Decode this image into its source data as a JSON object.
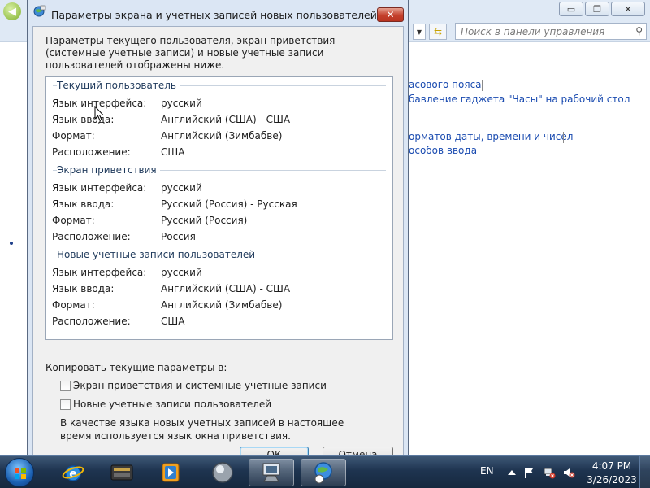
{
  "background_window": {
    "controls": {
      "minimize": "▭",
      "maximize": "❐",
      "close": "✕"
    },
    "address": {
      "dropdown": "▼",
      "refresh": "⇆"
    },
    "search": {
      "placeholder": "Поиск в панели управления"
    },
    "links": [
      {
        "text": "асового пояса"
      },
      {
        "text": "бавление гаджета \"Часы\" на рабочий стол"
      },
      {
        "text": "орматов даты, времени и чисел"
      },
      {
        "text": "особов ввода"
      }
    ]
  },
  "dialog": {
    "title": "Параметры экрана и учетных записей новых пользователей",
    "close_label": "✕",
    "intro": "Параметры текущего пользователя, экран приветствия (системные учетные записи) и новые учетные записи пользователей отображены ниже.",
    "sections": [
      {
        "title": "Текущий пользователь",
        "rows": [
          {
            "label": "Язык интерфейса:",
            "value": "русский"
          },
          {
            "label": "Язык ввода:",
            "value": "Английский (США) - США"
          },
          {
            "label": "Формат:",
            "value": "Английский (Зимбабве)"
          },
          {
            "label": "Расположение:",
            "value": "США"
          }
        ]
      },
      {
        "title": "Экран приветствия",
        "rows": [
          {
            "label": "Язык интерфейса:",
            "value": "русский"
          },
          {
            "label": "Язык ввода:",
            "value": "Русский (Россия) - Русская"
          },
          {
            "label": "Формат:",
            "value": "Русский (Россия)"
          },
          {
            "label": "Расположение:",
            "value": "Россия"
          }
        ]
      },
      {
        "title": "Новые учетные записи пользователей",
        "rows": [
          {
            "label": "Язык интерфейса:",
            "value": "русский"
          },
          {
            "label": "Язык ввода:",
            "value": "Английский (США) - США"
          },
          {
            "label": "Формат:",
            "value": "Английский (Зимбабве)"
          },
          {
            "label": "Расположение:",
            "value": "США"
          }
        ]
      }
    ],
    "copy_header": "Копировать текущие параметры в:",
    "checkboxes": [
      {
        "label": "Экран приветствия и системные учетные записи",
        "checked": false
      },
      {
        "label": "Новые учетные записи пользователей",
        "checked": false
      }
    ],
    "note": "В качестве языка новых учетных записей в настоящее время используется язык окна приветствия.",
    "ok_label": "ОК",
    "cancel_label": "Отмена"
  },
  "taskbar": {
    "items": [
      {
        "icon": "internet-explorer-icon",
        "active": false
      },
      {
        "icon": "video-editor-icon",
        "active": false
      },
      {
        "icon": "media-player-icon",
        "active": false
      },
      {
        "icon": "media-center-icon",
        "active": false
      },
      {
        "icon": "computer-icon",
        "active": true
      },
      {
        "icon": "globe-clock-icon",
        "active": true
      }
    ],
    "language": "EN",
    "time": "4:07 PM",
    "date": "3/26/2023"
  },
  "colors": {
    "dialog_frame": "#dbe6f4",
    "dialog_close": "#c4402c",
    "link": "#1a4bb0",
    "section_title": "#1e395b",
    "taskbar": "#1e3450"
  }
}
